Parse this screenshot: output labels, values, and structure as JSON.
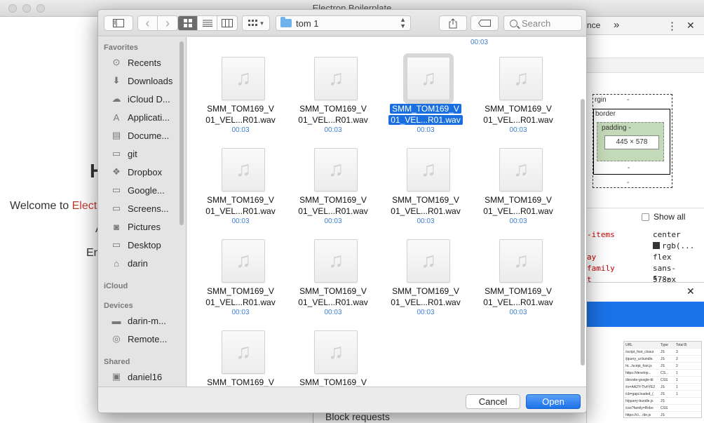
{
  "app": {
    "title": "Electron Boilerplate",
    "welcome_prefix": "Welcome to ",
    "welcome_accent": "Elect",
    "heading_fragment": "H",
    "fragment_a": "A",
    "fragment_en": "En"
  },
  "devtools": {
    "tab_partial": "nce",
    "more": "»",
    "menu": "⋮",
    "close": "✕",
    "box_margin": "rgin",
    "box_border": "border",
    "box_padding": "padding -",
    "box_size": "445 × 578",
    "dash": "-",
    "show_all": "Show all",
    "props": [
      {
        "k": "-items",
        "v": "center"
      },
      {
        "k": "",
        "v": "rgb(..."
      },
      {
        "k": "ay",
        "v": "flex"
      },
      {
        "k": "family",
        "v": "sans-s..."
      },
      {
        "k": "t",
        "v": "578px"
      }
    ],
    "panel_close": "✕",
    "network_header": [
      "URL",
      "Type",
      "Total B"
    ],
    "network_rows": [
      [
        "/script_foot_closur",
        "JS",
        "3"
      ],
      [
        "/jquery_ui-bundle.",
        "JS",
        "2"
      ],
      [
        "ht.../script_foot.js",
        "JS",
        "2"
      ],
      [
        "https://develop...",
        "CS...",
        "1"
      ],
      [
        "/devsite-google-bl",
        "CSS",
        "1"
      ],
      [
        "/rs=AA2YrTIvhYE2",
        "JS",
        "1"
      ],
      [
        "/cb=gapi.loaded_(",
        "JS",
        "1"
      ],
      [
        "h/jquery-bundle.js",
        "JS",
        ""
      ],
      [
        "/css?family=Robo",
        "CSS",
        ""
      ],
      [
        "https://cl... /dn.js",
        "JS",
        ""
      ],
      [
        "extensions::pan",
        "JS",
        ""
      ]
    ],
    "block_requests": "Block requests"
  },
  "dialog": {
    "toolbar": {
      "sidebar_toggle_icon": "sidebar-icon",
      "back": "‹",
      "forward": "›",
      "arrange": "▾",
      "share_icon": "share-icon",
      "tag_icon": "tag-icon",
      "folder": "tom 1",
      "search_placeholder": "Search"
    },
    "sidebar": {
      "favorites_heading": "Favorites",
      "favorites": [
        {
          "label": "Recents",
          "icon": "clock-icon",
          "glyph": "⊙"
        },
        {
          "label": "Downloads",
          "icon": "download-icon",
          "glyph": "⬇"
        },
        {
          "label": "iCloud D...",
          "icon": "cloud-icon",
          "glyph": "☁"
        },
        {
          "label": "Applicati...",
          "icon": "applications-icon",
          "glyph": "A"
        },
        {
          "label": "Docume...",
          "icon": "document-icon",
          "glyph": "▤"
        },
        {
          "label": "git",
          "icon": "folder-icon",
          "glyph": "▭"
        },
        {
          "label": "Dropbox",
          "icon": "dropbox-icon",
          "glyph": "❖"
        },
        {
          "label": "Google...",
          "icon": "folder-icon",
          "glyph": "▭"
        },
        {
          "label": "Screens...",
          "icon": "folder-icon",
          "glyph": "▭"
        },
        {
          "label": "Pictures",
          "icon": "camera-icon",
          "glyph": "◙"
        },
        {
          "label": "Desktop",
          "icon": "desktop-icon",
          "glyph": "▭"
        },
        {
          "label": "darin",
          "icon": "home-icon",
          "glyph": "⌂"
        }
      ],
      "icloud_heading": "iCloud",
      "devices_heading": "Devices",
      "devices": [
        {
          "label": "darin-m...",
          "icon": "laptop-icon",
          "glyph": "▬"
        },
        {
          "label": "Remote...",
          "icon": "disc-icon",
          "glyph": "◎"
        }
      ],
      "shared_heading": "Shared",
      "shared": [
        {
          "label": "daniel16",
          "icon": "monitor-icon",
          "glyph": "▣"
        }
      ]
    },
    "files": [
      {
        "line1": "SMM_TOM169_V",
        "line2": "01_VEL...R01.wav",
        "duration": "00:03",
        "selected": false
      },
      {
        "line1": "SMM_TOM169_V",
        "line2": "01_VEL...R01.wav",
        "duration": "00:03",
        "selected": false
      },
      {
        "line1": "SMM_TOM169_V",
        "line2": "01_VEL...R01.wav",
        "duration": "00:03",
        "selected": true
      },
      {
        "line1": "SMM_TOM169_V",
        "line2": "01_VEL...R01.wav",
        "duration": "00:03",
        "selected": false
      },
      {
        "line1": "SMM_TOM169_V",
        "line2": "01_VEL...R01.wav",
        "duration": "00:03",
        "selected": false
      },
      {
        "line1": "SMM_TOM169_V",
        "line2": "01_VEL...R01.wav",
        "duration": "00:03",
        "selected": false
      },
      {
        "line1": "SMM_TOM169_V",
        "line2": "01_VEL...R01.wav",
        "duration": "00:03",
        "selected": false
      },
      {
        "line1": "SMM_TOM169_V",
        "line2": "01_VEL...R01.wav",
        "duration": "00:03",
        "selected": false
      },
      {
        "line1": "SMM_TOM169_V",
        "line2": "01_VEL...R01.wav",
        "duration": "00:03",
        "selected": false
      },
      {
        "line1": "SMM_TOM169_V",
        "line2": "01_VEL...R01.wav",
        "duration": "00:03",
        "selected": false
      },
      {
        "line1": "SMM_TOM169_V",
        "line2": "01_VEL...R01.wav",
        "duration": "00:03",
        "selected": false
      },
      {
        "line1": "SMM_TOM169_V",
        "line2": "01_VEL...R01.wav",
        "duration": "00:03",
        "selected": false
      },
      {
        "line1": "SMM_TOM169_V",
        "line2": "",
        "duration": "",
        "selected": false
      },
      {
        "line1": "SMM_TOM169_V",
        "line2": "",
        "duration": "",
        "selected": false
      }
    ],
    "top_partial_duration": "00:03",
    "cancel": "Cancel",
    "open": "Open"
  },
  "colors": {
    "accent_blue": "#1a6fe0",
    "duration_blue": "#3d7fd0"
  }
}
